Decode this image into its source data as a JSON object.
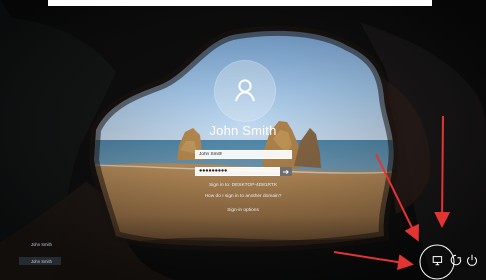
{
  "login": {
    "user_name": "John Smith",
    "username_value": "John Smith",
    "password_value": "●●●●●●●●●",
    "signin_to": "Sign in to: DESKTOP-4D81RTK",
    "domain_link": "How do I sign in to another domain?",
    "signin_options": "Sign-in options"
  },
  "bottom_users": [
    "John Smith",
    "John Smith"
  ],
  "icons": {
    "user": "user-icon",
    "submit": "arrow-right-icon",
    "network": "network-icon",
    "accessibility": "ease-of-access-icon",
    "power": "power-icon"
  },
  "colors": {
    "annotation_red": "#e33333",
    "field_bg": "#f4f4f4",
    "text_white": "#ffffff"
  }
}
